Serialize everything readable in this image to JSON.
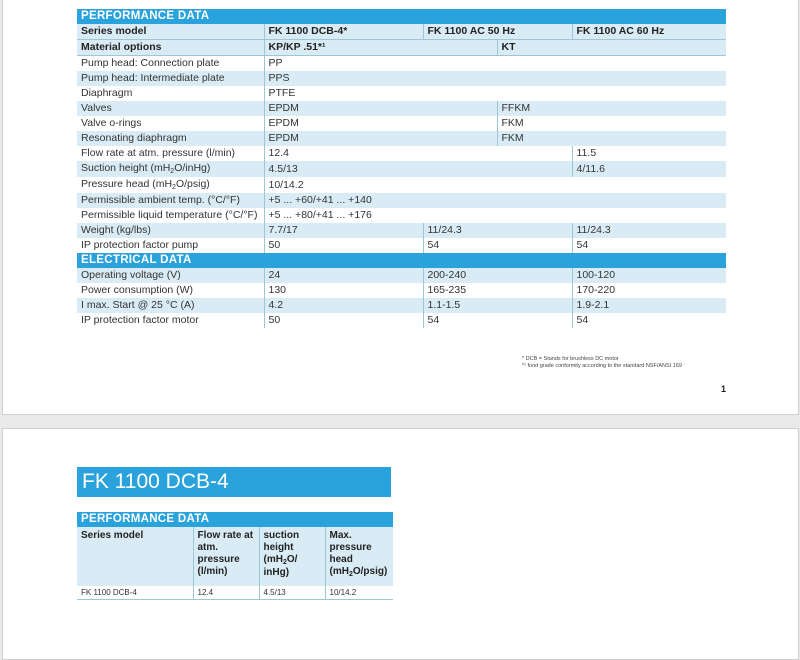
{
  "page1": {
    "perf_heading": "PERFORMANCE DATA",
    "series_label": "Series model",
    "series_cols": [
      "FK 1100 DCB-4*",
      "FK 1100 AC 50 Hz",
      "FK 1100 AC 60 Hz"
    ],
    "material_label": "Material options",
    "material_cols": [
      "KP/KP .51*¹",
      "KT"
    ],
    "rows_a": [
      {
        "label": "Pump head: Connection plate",
        "value": "PP"
      },
      {
        "label": "Pump head: Intermediate plate",
        "value": "PPS"
      },
      {
        "label": "Diaphragm",
        "value": "PTFE"
      }
    ],
    "rows_b": [
      {
        "label": "Valves",
        "kp": "EPDM",
        "kt": "FFKM"
      },
      {
        "label": "Valve o-rings",
        "kp": "EPDM",
        "kt": "FKM"
      },
      {
        "label": "Resonating diaphragm",
        "kp": "EPDM",
        "kt": "FKM"
      }
    ],
    "flow_rate": {
      "label": "Flow rate at atm. pressure (l/min)",
      "dcb": "12.4",
      "ac60": "11.5"
    },
    "suction_height": {
      "label_pre": "Suction height (mH",
      "label_sub": "2",
      "label_post": "O/inHg)",
      "dcb": "4.5/13",
      "ac60": "4/11.6"
    },
    "pressure_head": {
      "label_pre": "Pressure head (mH",
      "label_sub": "2",
      "label_post": "O/psig)",
      "value": "10/14.2"
    },
    "ambient_temp": {
      "label": "Permissible ambient temp. (°C/°F)",
      "value": "+5 ... +60/+41 ... +140"
    },
    "liquid_temp": {
      "label": "Permissible liquid temperature (°C/°F)",
      "value": "+5 ... +80/+41 ... +176"
    },
    "weight": {
      "label": "Weight (kg/lbs)",
      "dcb": "7.7/17",
      "ac50": "11/24.3",
      "ac60": "11/24.3"
    },
    "ip_pump": {
      "label": "IP protection factor pump",
      "dcb": "50",
      "ac50": "54",
      "ac60": "54"
    },
    "elec_heading": "ELECTRICAL DATA",
    "elec_rows": [
      {
        "label": "Operating voltage (V)",
        "dcb": "24",
        "ac50": "200-240",
        "ac60": "100-120"
      },
      {
        "label": "Power consumption (W)",
        "dcb": "130",
        "ac50": "165-235",
        "ac60": "170-220"
      },
      {
        "label": "I max. Start @ 25 °C (A)",
        "dcb": "4.2",
        "ac50": "1.1-1.5",
        "ac60": "1.9-2.1"
      },
      {
        "label": "IP protection factor motor",
        "dcb": "50",
        "ac50": "54",
        "ac60": "54"
      }
    ],
    "footnote1": "*  DCB = Stands for brushless DC motor",
    "footnote2": "*¹ food grade conformity according to the standard NSF/ANSI 169",
    "page_number": "1"
  },
  "page2": {
    "title": "FK 1100 DCB-4",
    "perf_heading": "PERFORMANCE DATA",
    "col_series": "Series model",
    "col_flow": "Flow rate at atm. pressure (l/min)",
    "col_suction_pre": "suction height (mH",
    "col_suction_sub": "2",
    "col_suction_post": "O/ inHg)",
    "col_head_pre": "Max. pressure head (mH",
    "col_head_sub": "2",
    "col_head_post": "O/psig)",
    "row": {
      "model": "FK 1100 DCB-4",
      "flow": "12.4",
      "suction": "4.5/13",
      "head": "10/14.2"
    }
  },
  "colors": {
    "accent": "#2aa2dc",
    "row_tint": "#d9ecf5",
    "rule": "#9ec5d8"
  }
}
